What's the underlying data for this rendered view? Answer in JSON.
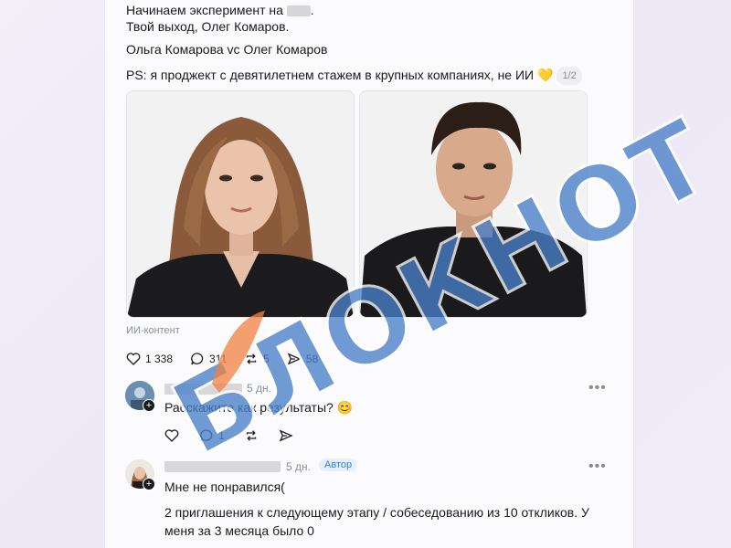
{
  "post": {
    "line1_start": "Начинаем эксперимент на ",
    "line1_end": ".",
    "line2": "Твой выход, Олег Комаров.",
    "line3": "Ольга Комарова vc Олег Комаров",
    "line4": "PS: я проджект с девятилетнем стажем в крупных компаниях, не ИИ 💛",
    "page_indicator": "1/2",
    "ai_label": "ИИ-контент",
    "likes": "1 338",
    "comments": "311",
    "reposts": "5",
    "shares": "58"
  },
  "comment1": {
    "time": "5 дн.",
    "text": "Расскажите как результаты? 😊",
    "comments": "1"
  },
  "comment2": {
    "time": "5 дн.",
    "author_badge": "Автор",
    "text1": "Мне не понравился(",
    "text2": "2 приглашения к следующему этапу / собеседованию из 10 откликов. У меня за 3 месяца было 0"
  },
  "watermark": {
    "text": "БЛОКНОТ"
  },
  "colors": {
    "accent": "#2f7ee8",
    "watermark_blue": "#4a80c8",
    "watermark_orange": "#f08040"
  }
}
